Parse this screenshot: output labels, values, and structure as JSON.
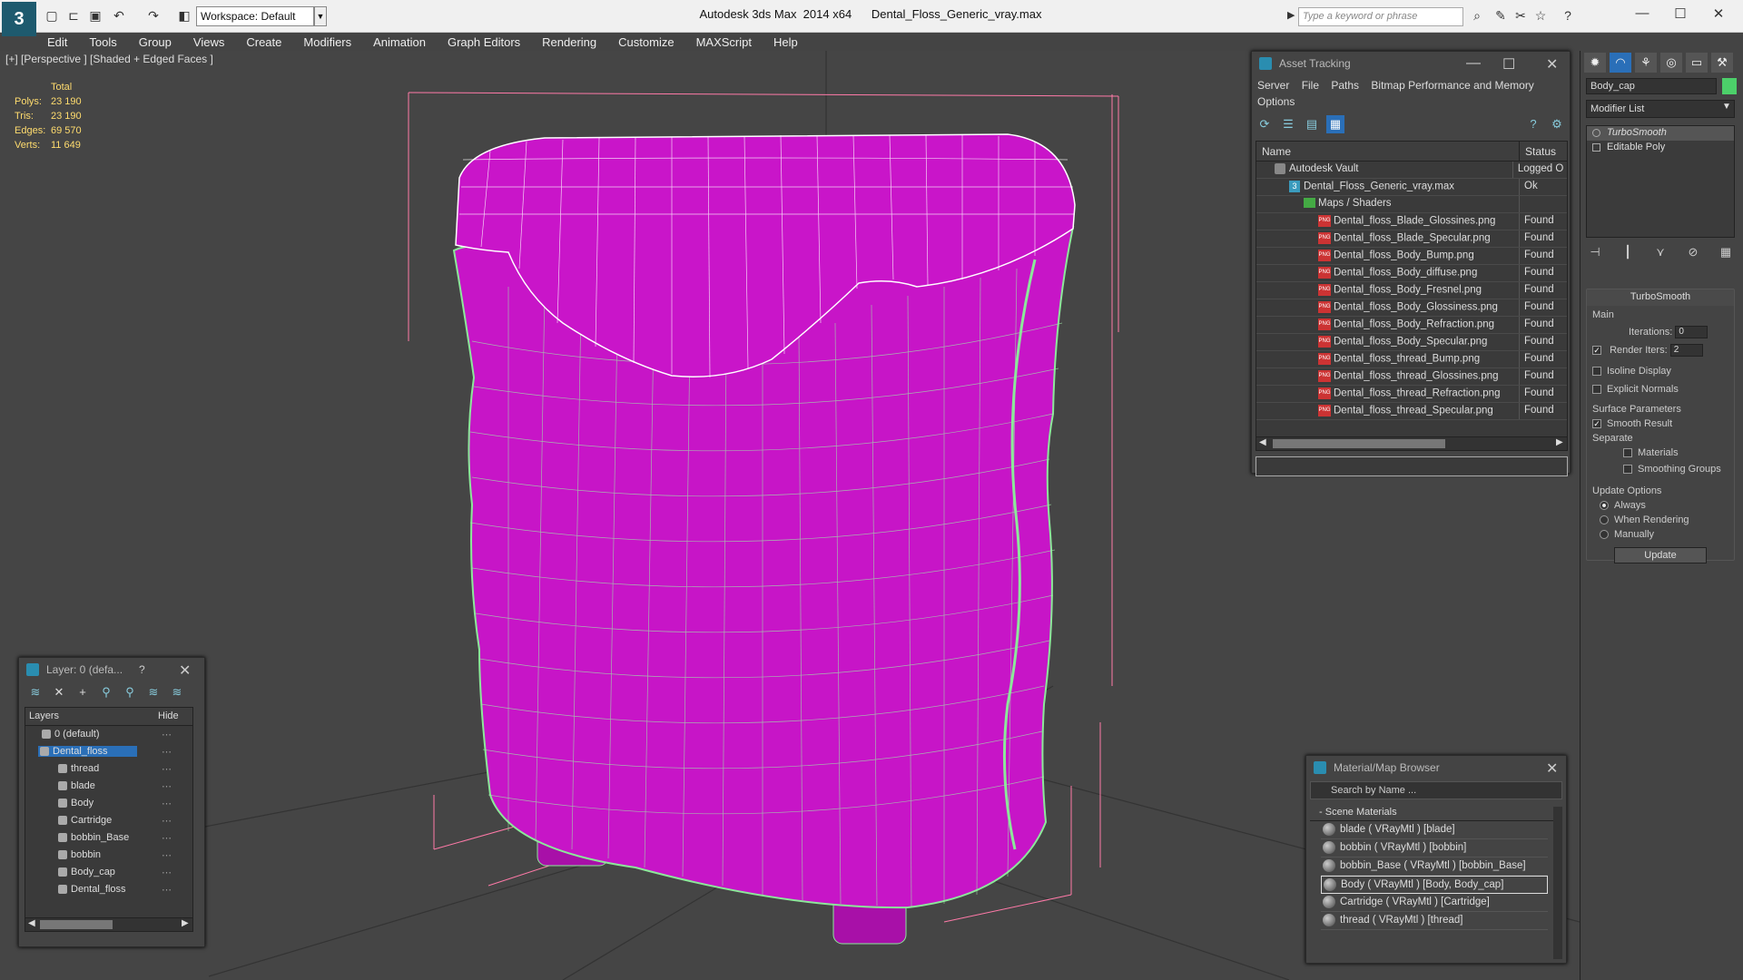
{
  "titlebar": {
    "app_title": "Autodesk 3ds Max  2014 x64      Dental_Floss_Generic_vray.max",
    "workspace": "Workspace: Default",
    "search_placeholder": "Type a keyword or phrase"
  },
  "menu": [
    "Edit",
    "Tools",
    "Group",
    "Views",
    "Create",
    "Modifiers",
    "Animation",
    "Graph Editors",
    "Rendering",
    "Customize",
    "MAXScript",
    "Help"
  ],
  "viewport": {
    "label": "[+] [Perspective ] [Shaded + Edged Faces ]",
    "stats_header": "Total",
    "stats": [
      {
        "label": "Polys:",
        "value": "23 190"
      },
      {
        "label": "Tris:",
        "value": "23 190"
      },
      {
        "label": "Edges:",
        "value": "69 570"
      },
      {
        "label": "Verts:",
        "value": "11 649"
      }
    ],
    "mesh_color": "#c815c8",
    "wire_color": "#8ce89a"
  },
  "asset_tracking": {
    "title": "Asset Tracking",
    "menus": [
      "Server",
      "File",
      "Paths",
      "Bitmap Performance and Memory",
      "Options"
    ],
    "col_name": "Name",
    "col_status": "Status",
    "rows": [
      {
        "name": "Autodesk Vault",
        "status": "Logged O",
        "icon": "vault",
        "indent": 20
      },
      {
        "name": "Dental_Floss_Generic_vray.max",
        "status": "Ok",
        "icon": "max",
        "indent": 36
      },
      {
        "name": "Maps / Shaders",
        "status": "",
        "icon": "folder",
        "indent": 52
      },
      {
        "name": "Dental_floss_Blade_Glossines.png",
        "status": "Found",
        "icon": "png",
        "indent": 68
      },
      {
        "name": "Dental_floss_Blade_Specular.png",
        "status": "Found",
        "icon": "png",
        "indent": 68
      },
      {
        "name": "Dental_floss_Body_Bump.png",
        "status": "Found",
        "icon": "png",
        "indent": 68
      },
      {
        "name": "Dental_floss_Body_diffuse.png",
        "status": "Found",
        "icon": "png",
        "indent": 68
      },
      {
        "name": "Dental_floss_Body_Fresnel.png",
        "status": "Found",
        "icon": "png",
        "indent": 68
      },
      {
        "name": "Dental_floss_Body_Glossiness.png",
        "status": "Found",
        "icon": "png",
        "indent": 68
      },
      {
        "name": "Dental_floss_Body_Refraction.png",
        "status": "Found",
        "icon": "png",
        "indent": 68
      },
      {
        "name": "Dental_floss_Body_Specular.png",
        "status": "Found",
        "icon": "png",
        "indent": 68
      },
      {
        "name": "Dental_floss_thread_Bump.png",
        "status": "Found",
        "icon": "png",
        "indent": 68
      },
      {
        "name": "Dental_floss_thread_Glossines.png",
        "status": "Found",
        "icon": "png",
        "indent": 68
      },
      {
        "name": "Dental_floss_thread_Refraction.png",
        "status": "Found",
        "icon": "png",
        "indent": 68
      },
      {
        "name": "Dental_floss_thread_Specular.png",
        "status": "Found",
        "icon": "png",
        "indent": 68
      }
    ]
  },
  "command_panel": {
    "object_name": "Body_cap",
    "modifier_list": "Modifier List",
    "stack": [
      "TurboSmooth",
      "Editable Poly"
    ],
    "turbosmooth": {
      "title": "TurboSmooth",
      "main": "Main",
      "iterations_label": "Iterations:",
      "iterations": "0",
      "render_iters_label": "Render Iters:",
      "render_iters": "2",
      "isoline": "Isoline Display",
      "explicit": "Explicit Normals",
      "surface": "Surface Parameters",
      "smooth_result": "Smooth Result",
      "separate": "Separate",
      "materials": "Materials",
      "smoothing_groups": "Smoothing Groups",
      "update_options": "Update Options",
      "always": "Always",
      "when_rendering": "When Rendering",
      "manually": "Manually",
      "update": "Update"
    }
  },
  "layers": {
    "title": "Layer: 0 (defa...",
    "help": "?",
    "col_layers": "Layers",
    "col_hide": "Hide",
    "rows": [
      {
        "name": "0 (default)",
        "indent": 18,
        "selected": false
      },
      {
        "name": "Dental_floss",
        "indent": 18,
        "selected": true
      },
      {
        "name": "thread",
        "indent": 36,
        "selected": false
      },
      {
        "name": "blade",
        "indent": 36,
        "selected": false
      },
      {
        "name": "Body",
        "indent": 36,
        "selected": false
      },
      {
        "name": "Cartridge",
        "indent": 36,
        "selected": false
      },
      {
        "name": "bobbin_Base",
        "indent": 36,
        "selected": false
      },
      {
        "name": "bobbin",
        "indent": 36,
        "selected": false
      },
      {
        "name": "Body_cap",
        "indent": 36,
        "selected": false
      },
      {
        "name": "Dental_floss",
        "indent": 36,
        "selected": false
      }
    ]
  },
  "material_browser": {
    "title": "Material/Map Browser",
    "search": "Search by Name ...",
    "group": "Scene Materials",
    "items": [
      "blade  ( VRayMtl ) [blade]",
      "bobbin  ( VRayMtl ) [bobbin]",
      "bobbin_Base  ( VRayMtl ) [bobbin_Base]",
      "Body  ( VRayMtl ) [Body, Body_cap]",
      "Cartridge  ( VRayMtl ) [Cartridge]",
      "thread  ( VRayMtl ) [thread]"
    ]
  }
}
